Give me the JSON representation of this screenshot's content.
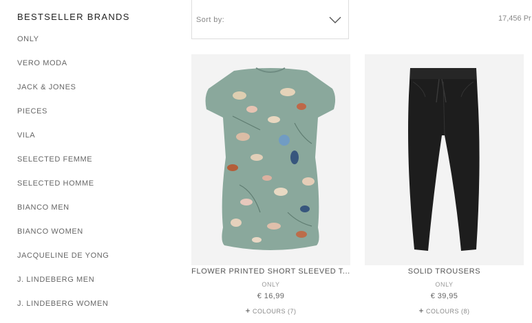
{
  "sidebar": {
    "title": "BESTSELLER BRANDS",
    "brands": [
      "ONLY",
      "VERO MODA",
      "JACK & JONES",
      "PIECES",
      "VILA",
      "SELECTED FEMME",
      "SELECTED HOMME",
      "BIANCO MEN",
      "BIANCO WOMEN",
      "JACQUELINE DE YONG",
      "J. LINDEBERG MEN",
      "J. LINDEBERG WOMEN"
    ]
  },
  "toolbar": {
    "sort_label": "Sort by:",
    "sort_icon": "chevron-down-icon",
    "result_count": "17,456 Pr"
  },
  "products": [
    {
      "name": "FLOWER PRINTED SHORT SLEEVED T...",
      "brand": "ONLY",
      "price": "€ 16,99",
      "colours_plus": "+",
      "colours": "COLOURS (7)",
      "image": "floral-tshirt"
    },
    {
      "name": "SOLID TROUSERS",
      "brand": "ONLY",
      "price": "€ 39,95",
      "colours_plus": "+",
      "colours": "COLOURS (8)",
      "image": "black-trousers"
    }
  ],
  "colors": {
    "image_bg": "#f3f3f3",
    "tshirt_base": "#8aa89c",
    "trousers": "#1d1d1d"
  }
}
